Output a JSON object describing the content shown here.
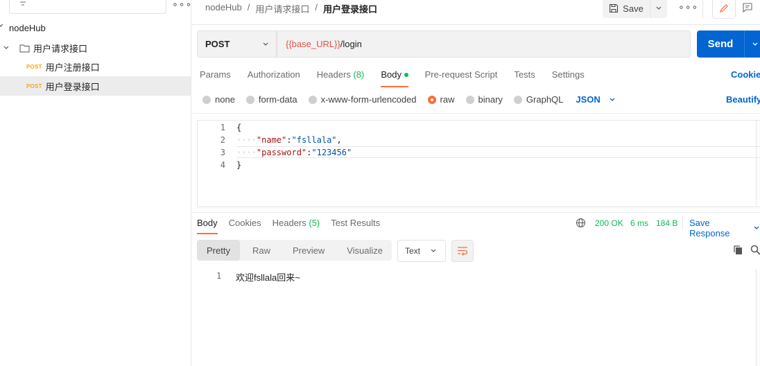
{
  "sidebar": {
    "workspace": "nodeHub",
    "folder": "用户请求接口",
    "requests": [
      {
        "method": "POST",
        "name": "用户注册接口",
        "active": false
      },
      {
        "method": "POST",
        "name": "用户登录接口",
        "active": true
      }
    ]
  },
  "header": {
    "breadcrumb": [
      "nodeHub",
      "用户请求接口",
      "用户登录接口"
    ],
    "separator": "/",
    "save_label": "Save"
  },
  "request": {
    "method": "POST",
    "url_variable": "{{base_URL}}",
    "url_path": "/login",
    "send_label": "Send"
  },
  "request_tabs": [
    {
      "label": "Params"
    },
    {
      "label": "Authorization"
    },
    {
      "label": "Headers",
      "count": "(8)"
    },
    {
      "label": "Body",
      "active": true
    },
    {
      "label": "Pre-request Script"
    },
    {
      "label": "Tests"
    },
    {
      "label": "Settings"
    }
  ],
  "cookies_label": "Cookies",
  "body_types": [
    {
      "label": "none",
      "selected": false
    },
    {
      "label": "form-data",
      "selected": false
    },
    {
      "label": "x-www-form-urlencoded",
      "selected": false
    },
    {
      "label": "raw",
      "selected": true
    },
    {
      "label": "binary",
      "selected": false
    },
    {
      "label": "GraphQL",
      "selected": false
    }
  ],
  "raw_format": "JSON",
  "beautify_label": "Beautify",
  "body_code": {
    "line_numbers": [
      "1",
      "2",
      "3",
      "4"
    ],
    "open": "{",
    "close": "}",
    "key1": "\"name\"",
    "val1": "\"fsllala\"",
    "key2": "\"password\"",
    "val2": "\"123456\""
  },
  "response": {
    "tabs": [
      {
        "label": "Body",
        "active": true
      },
      {
        "label": "Cookies"
      },
      {
        "label": "Headers",
        "count": "(5)"
      },
      {
        "label": "Test Results"
      }
    ],
    "status": "200 OK",
    "time": "6 ms",
    "size": "184 B",
    "save_response_label": "Save Response",
    "views": [
      "Pretty",
      "Raw",
      "Preview",
      "Visualize"
    ],
    "active_view": "Pretty",
    "format": "Text",
    "line_number": "1",
    "content": "欢迎fsllala回来~"
  },
  "colors": {
    "accent": "#ff6c37",
    "send_blue": "#0265d2",
    "status_green": "#0cbb52",
    "variable_red": "#e05243"
  }
}
